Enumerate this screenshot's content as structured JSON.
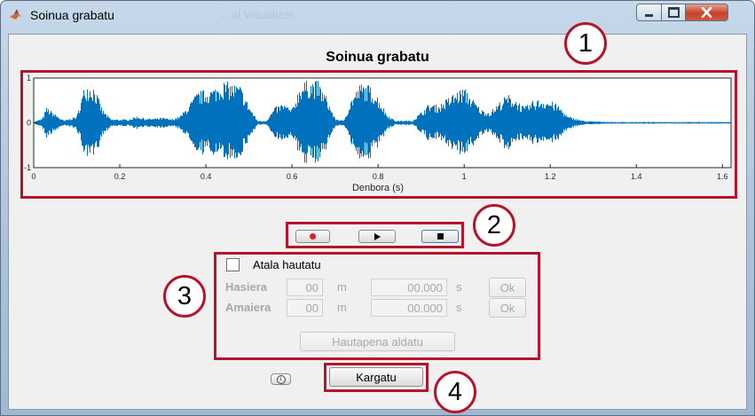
{
  "window": {
    "title": "Soinua grabatu",
    "ghost_title": "...al Visualizer",
    "controls": [
      "minimize",
      "maximize",
      "close"
    ]
  },
  "plot": {
    "title": "Soinua grabatu",
    "xlabel": "Denbora (s)",
    "ylabel": "",
    "x_ticks": [
      "0",
      "0.2",
      "0.4",
      "0.6",
      "0.8",
      "1",
      "1.2",
      "1.4",
      "1.6"
    ],
    "y_ticks": [
      "1",
      "0",
      "-1"
    ],
    "line_color": "#0072bd"
  },
  "chart_data": {
    "type": "line",
    "title": "Soinua grabatu",
    "xlabel": "Denbora (s)",
    "ylabel": "",
    "xlim": [
      0,
      1.62
    ],
    "ylim": [
      -1,
      1
    ],
    "envelope": {
      "x": [
        0,
        0.02,
        0.03,
        0.05,
        0.07,
        0.1,
        0.12,
        0.14,
        0.16,
        0.18,
        0.22,
        0.24,
        0.26,
        0.28,
        0.3,
        0.32,
        0.34,
        0.36,
        0.38,
        0.4,
        0.42,
        0.44,
        0.46,
        0.48,
        0.5,
        0.52,
        0.54,
        0.56,
        0.58,
        0.6,
        0.62,
        0.64,
        0.66,
        0.68,
        0.7,
        0.72,
        0.74,
        0.76,
        0.78,
        0.8,
        0.82,
        0.84,
        0.86,
        0.88,
        0.9,
        0.92,
        0.94,
        0.96,
        0.98,
        1.0,
        1.02,
        1.04,
        1.06,
        1.08,
        1.1,
        1.12,
        1.14,
        1.16,
        1.18,
        1.2,
        1.22,
        1.24,
        1.28,
        1.35,
        1.45,
        1.55,
        1.62
      ],
      "amplitude": [
        0.02,
        0.1,
        0.35,
        0.2,
        0.05,
        0.15,
        0.9,
        0.85,
        0.3,
        0.08,
        0.08,
        0.15,
        0.1,
        0.1,
        0.12,
        0.08,
        0.15,
        0.4,
        0.7,
        0.75,
        0.8,
        0.95,
        0.9,
        0.85,
        0.4,
        0.05,
        0.05,
        0.35,
        0.45,
        0.3,
        0.9,
        0.98,
        0.95,
        0.6,
        0.1,
        0.05,
        0.6,
        0.9,
        0.85,
        0.6,
        0.2,
        0.05,
        0.05,
        0.05,
        0.25,
        0.45,
        0.4,
        0.55,
        0.7,
        0.8,
        0.55,
        0.3,
        0.25,
        0.45,
        0.65,
        0.55,
        0.35,
        0.5,
        0.55,
        0.5,
        0.4,
        0.15,
        0.04,
        0.02,
        0.02,
        0.02,
        0.02
      ]
    }
  },
  "playback": {
    "record_icon": "record-icon",
    "play_icon": "play-icon",
    "stop_icon": "stop-icon",
    "record_color": "#e0201c"
  },
  "segment": {
    "checkbox_label": "Atala hautatu",
    "checked": false,
    "start_label": "Hasiera",
    "end_label": "Amaiera",
    "start_minutes": "00",
    "end_minutes": "00",
    "minutes_unit": "m",
    "start_seconds": "00.000",
    "end_seconds": "00.000",
    "seconds_unit": "s",
    "ok_label": "Ok",
    "cut_button": "Hautapena aldatu"
  },
  "footer": {
    "info_icon": "info-icon",
    "load_button": "Kargatu"
  },
  "annotations": {
    "n1": "1",
    "n2": "2",
    "n3": "3",
    "n4": "4",
    "color": "#b4152a"
  }
}
